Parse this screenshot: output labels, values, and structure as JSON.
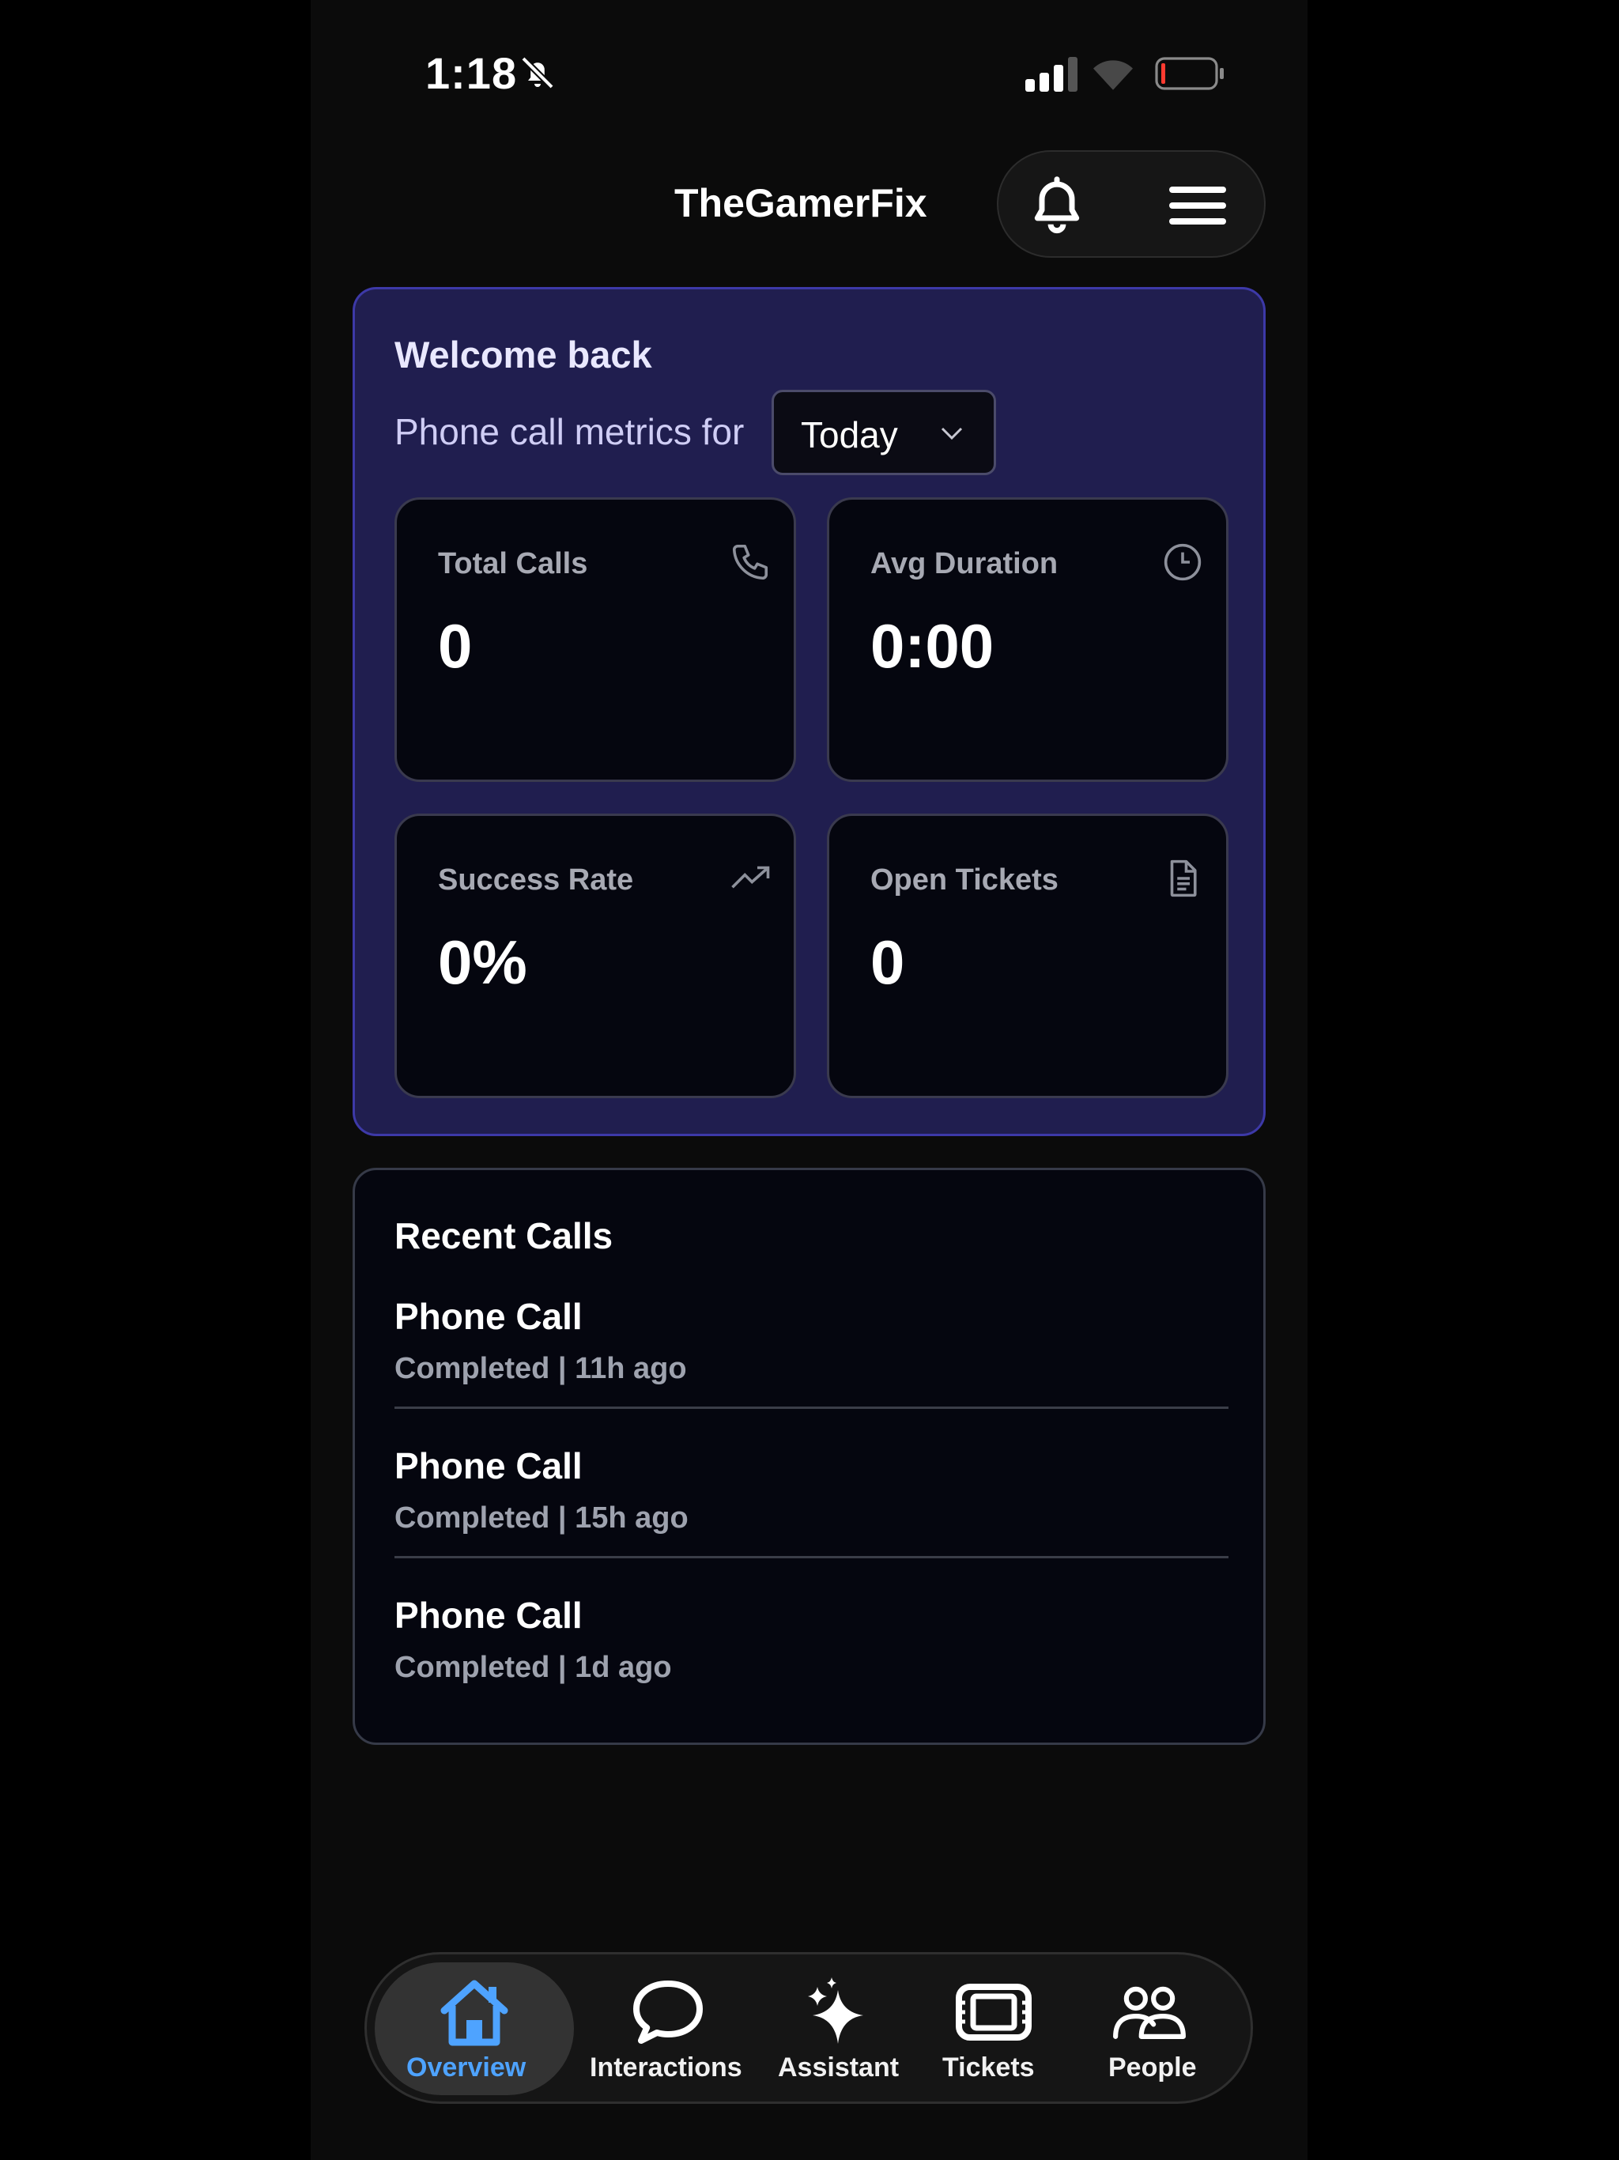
{
  "status_bar": {
    "time": "1:18"
  },
  "header": {
    "title": "TheGamerFix"
  },
  "welcome": {
    "title": "Welcome back",
    "metrics_label": "Phone call metrics for",
    "period": "Today"
  },
  "metrics": [
    {
      "label": "Total Calls",
      "value": "0",
      "icon": "phone-icon"
    },
    {
      "label": "Avg Duration",
      "value": "0:00",
      "icon": "clock-icon"
    },
    {
      "label": "Success Rate",
      "value": "0%",
      "icon": "trending-up-icon"
    },
    {
      "label": "Open Tickets",
      "value": "0",
      "icon": "document-icon"
    }
  ],
  "recent": {
    "title": "Recent Calls",
    "calls": [
      {
        "title": "Phone Call",
        "meta": "Completed | 11h ago"
      },
      {
        "title": "Phone Call",
        "meta": "Completed | 15h ago"
      },
      {
        "title": "Phone Call",
        "meta": "Completed | 1d ago"
      }
    ]
  },
  "tabs": [
    {
      "label": "Overview",
      "icon": "home-icon",
      "active": true
    },
    {
      "label": "Interactions",
      "icon": "chat-bubble-icon",
      "active": false
    },
    {
      "label": "Assistant",
      "icon": "sparkles-icon",
      "active": false
    },
    {
      "label": "Tickets",
      "icon": "ticket-icon",
      "active": false
    },
    {
      "label": "People",
      "icon": "people-icon",
      "active": false
    }
  ],
  "colors": {
    "accent": "#4ea3ff",
    "welcome_bg": "#201e4f",
    "welcome_border": "#3d39a8",
    "card_bg": "#05060f"
  }
}
